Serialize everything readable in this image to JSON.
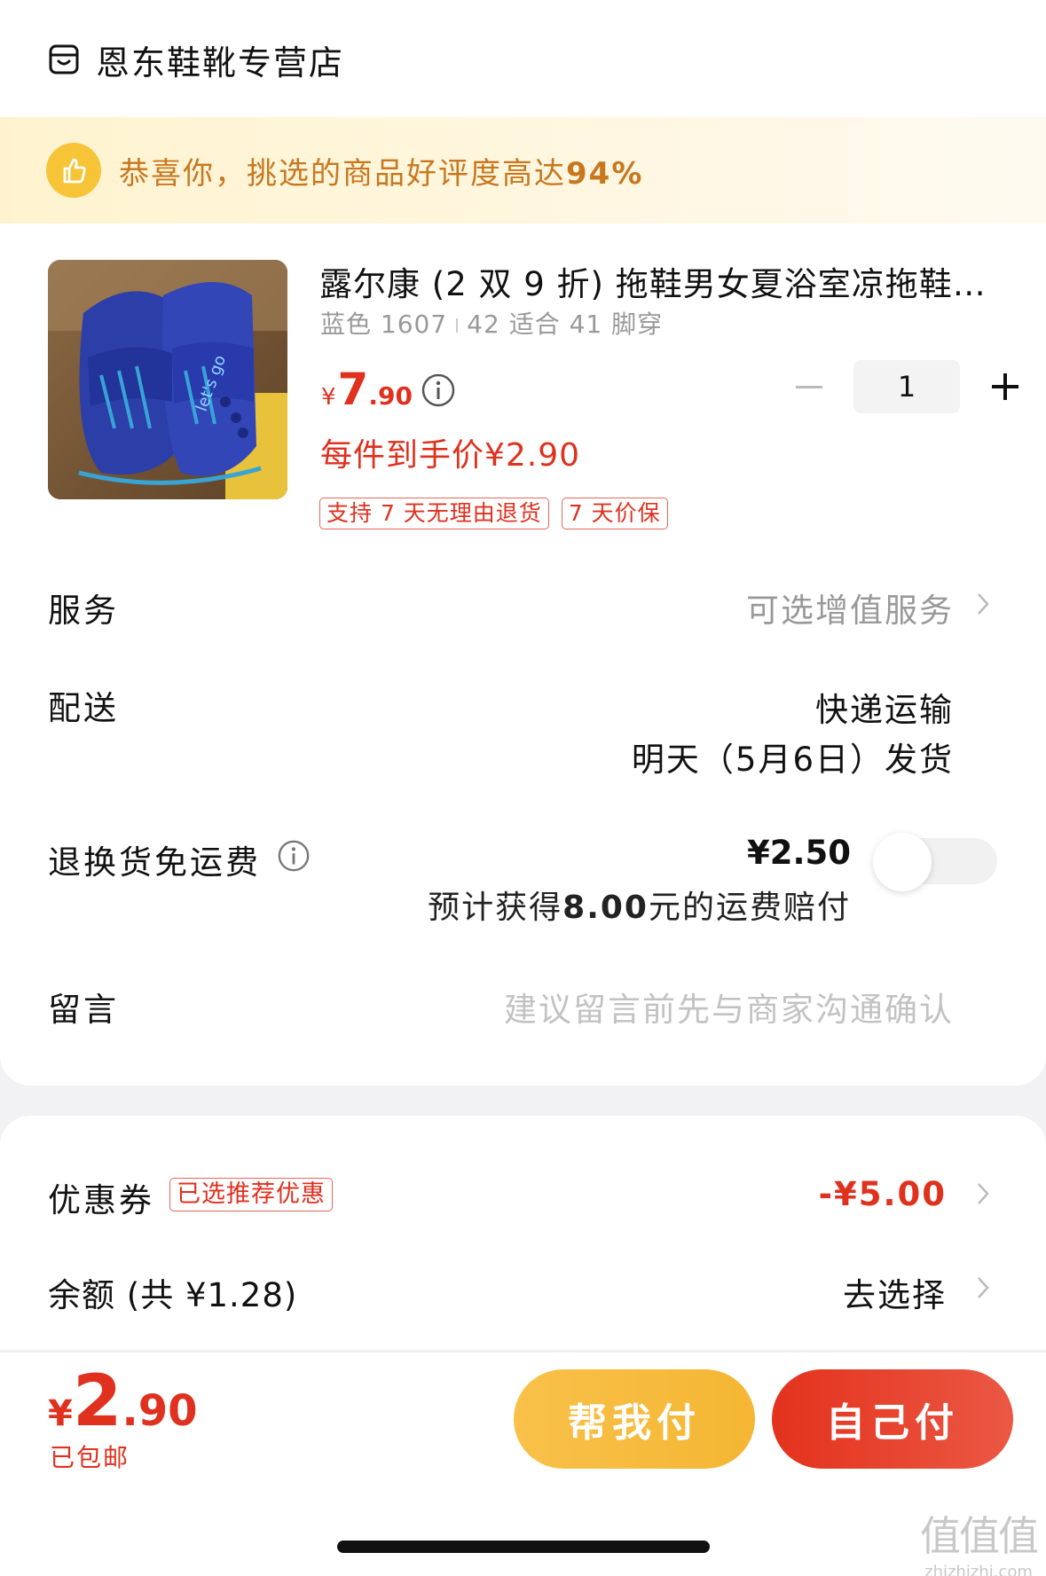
{
  "store": {
    "name": "恩东鞋靴专营店",
    "icon": "store-icon"
  },
  "praise": {
    "text": "恭喜你，挑选的商品好评度高达",
    "percent": "94%",
    "icon": "thumbs-up-icon"
  },
  "product": {
    "title": "露尔康 (2 双 9 折) 拖鞋男女夏浴室凉拖鞋…",
    "spec_color": "蓝色 1607",
    "spec_size": "42 适合 41 脚穿",
    "price_yen": "¥",
    "price_int": "7",
    "price_dec": ".90",
    "quantity": "1",
    "unit_price": "每件到手价¥2.90",
    "tags": [
      "支持 7 天无理由退货",
      "7 天价保"
    ],
    "image_text": "let's go"
  },
  "service": {
    "label": "服务",
    "value": "可选增值服务"
  },
  "delivery": {
    "label": "配送",
    "method": "快递运输",
    "date": "明天（5月6日）发货"
  },
  "return_shipping": {
    "label": "退换货免运费",
    "price": "¥2.50",
    "note_prefix": "预计获得",
    "note_amount": "8.00",
    "note_suffix": "元的运费赔付",
    "toggle_on": false
  },
  "message": {
    "label": "留言",
    "placeholder": "建议留言前先与商家沟通确认"
  },
  "coupon": {
    "label": "优惠券",
    "tag": "已选推荐优惠",
    "value": "-¥5.00"
  },
  "balance": {
    "label": "余额 (共 ¥1.28)",
    "value": "去选择"
  },
  "footer": {
    "total_yen": "¥",
    "total_int": "2",
    "total_dec": ".90",
    "shipping": "已包邮",
    "help_pay": "帮我付",
    "self_pay": "自己付"
  },
  "watermark": {
    "big": "值值值",
    "small": "zhizhizhi.com"
  },
  "colors": {
    "accent_red": "#e0301e",
    "gold": "#f4b633",
    "praise_text": "#c7781f"
  }
}
